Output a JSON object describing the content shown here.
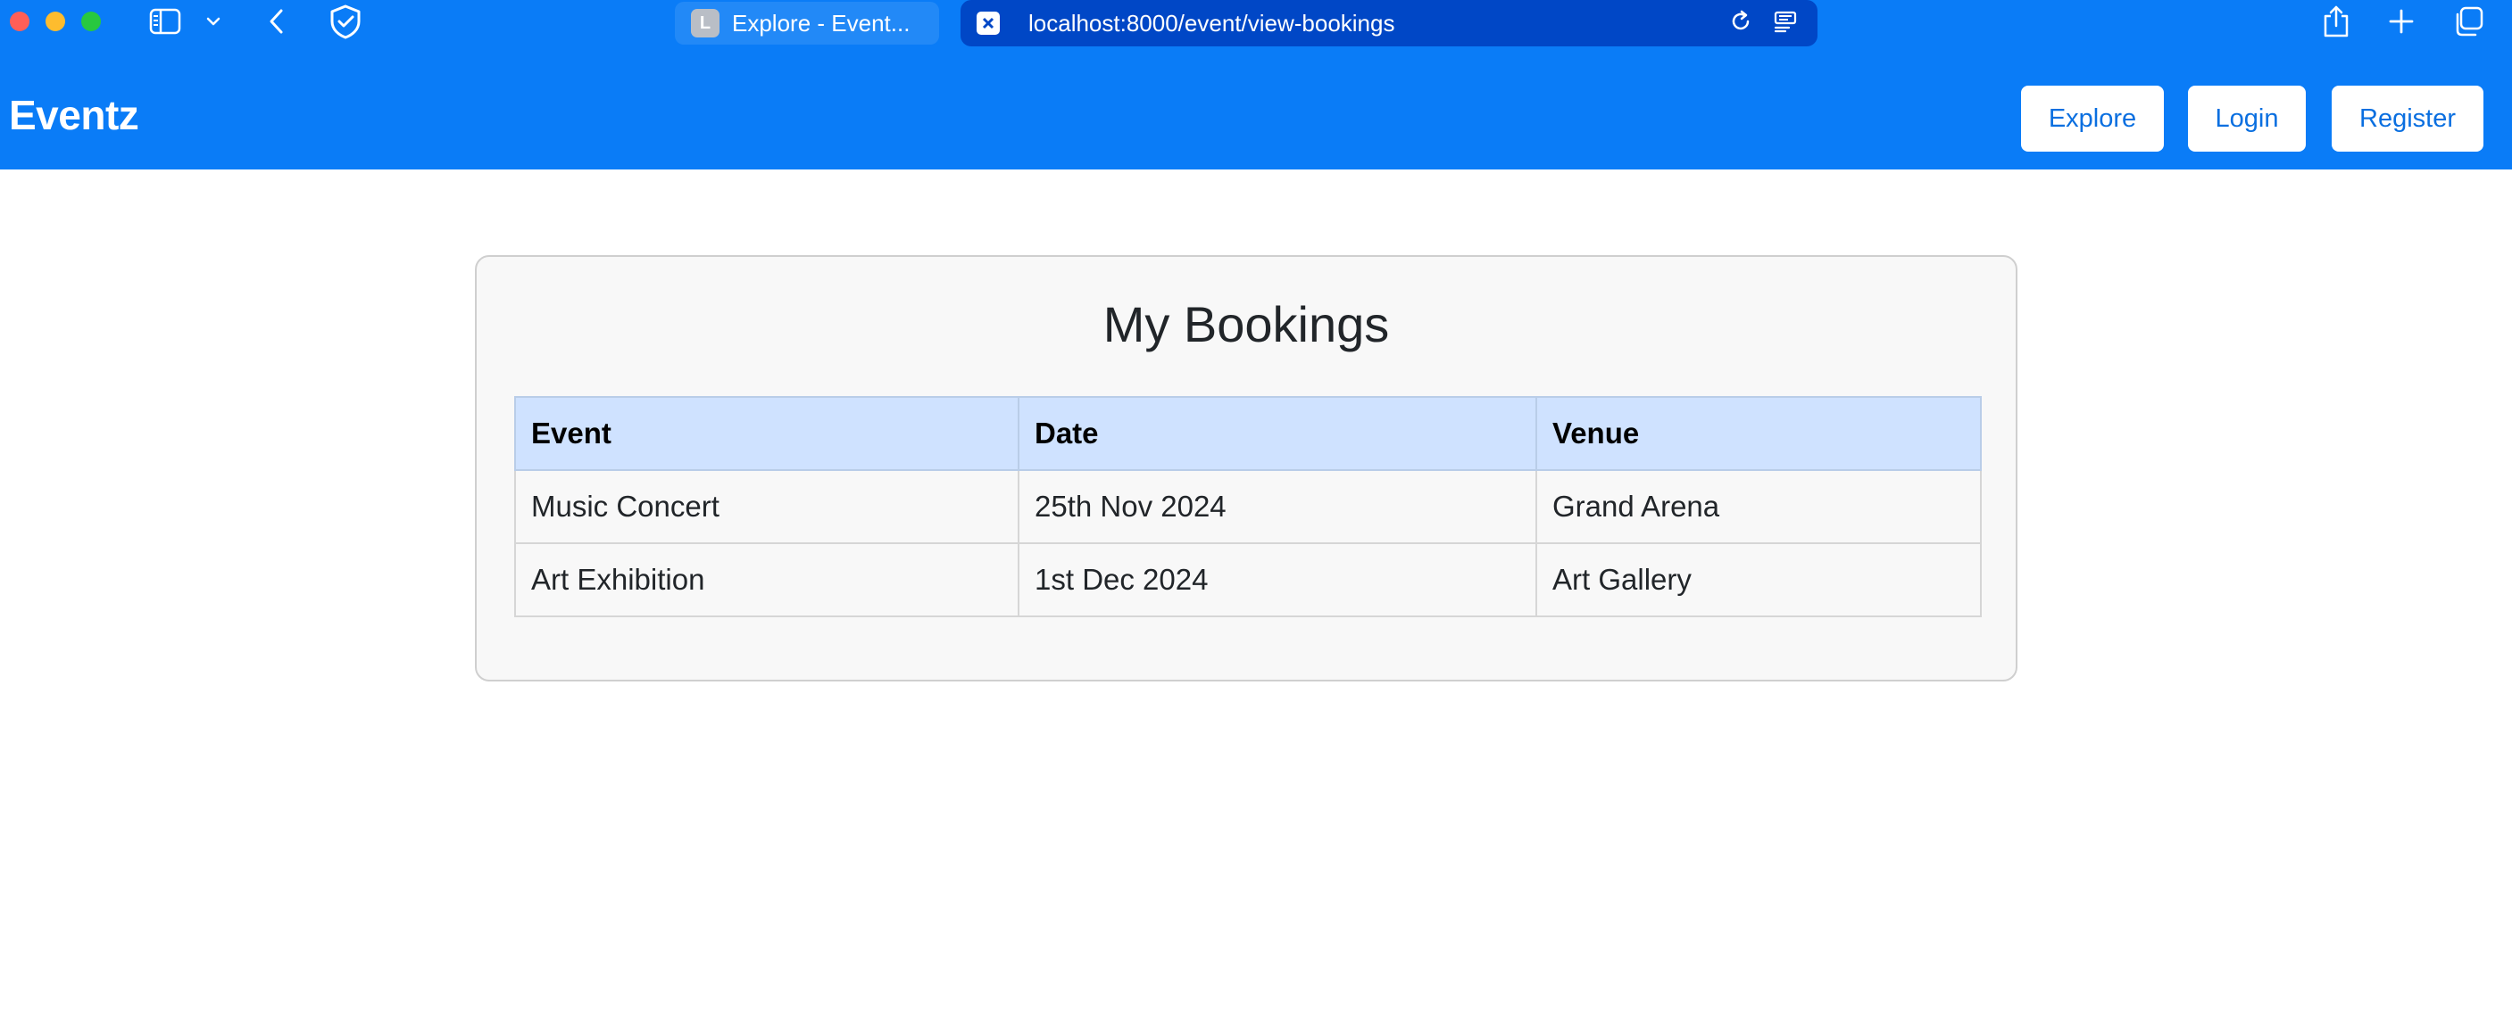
{
  "browser": {
    "tabs": [
      {
        "favicon_letter": "L",
        "label": "Explore - Event..."
      }
    ],
    "url": "localhost:8000/event/view-bookings"
  },
  "navbar": {
    "brand": "Eventz",
    "buttons": {
      "explore": "Explore",
      "login": "Login",
      "register": "Register"
    }
  },
  "bookings": {
    "title": "My Bookings",
    "columns": [
      "Event",
      "Date",
      "Venue"
    ],
    "rows": [
      [
        "Music Concert",
        "25th Nov 2024",
        "Grand Arena"
      ],
      [
        "Art Exhibition",
        "1st Dec 2024",
        "Art Gallery"
      ]
    ]
  },
  "colors": {
    "brand_blue": "#0a7cf7",
    "url_bar": "#0047c6",
    "table_header": "#cfe2ff",
    "card_background": "#f8f8f8"
  }
}
